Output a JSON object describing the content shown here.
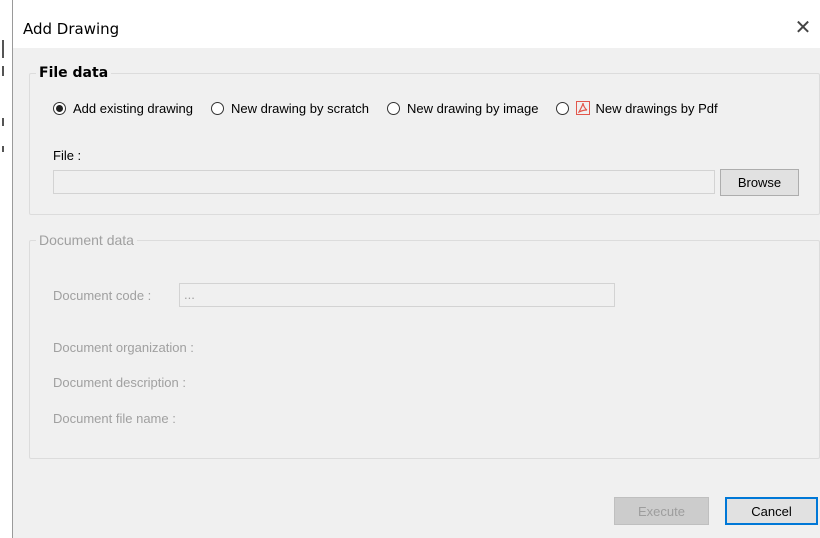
{
  "window": {
    "title": "Add Drawing",
    "close_glyph": "✕"
  },
  "file_data": {
    "legend": "File data",
    "options": [
      {
        "label": "Add existing drawing",
        "selected": true
      },
      {
        "label": "New drawing by scratch",
        "selected": false
      },
      {
        "label": "New drawing by image",
        "selected": false
      },
      {
        "label": "New drawings by Pdf",
        "selected": false,
        "icon": "pdf-icon"
      }
    ],
    "file_label": "File :",
    "file_value": "",
    "browse_label": "Browse"
  },
  "document_data": {
    "legend": "Document data",
    "code_label": "Document code :",
    "code_value": "...",
    "organization_label": "Document organization :",
    "description_label": "Document description :",
    "file_name_label": "Document file name :"
  },
  "actions": {
    "execute_label": "Execute",
    "cancel_label": "Cancel"
  },
  "colors": {
    "dialog_background": "#f0f0f0",
    "focus_border": "#0078d7",
    "disabled_text": "#a0a0a0",
    "pdf_icon": "#e2574c"
  }
}
